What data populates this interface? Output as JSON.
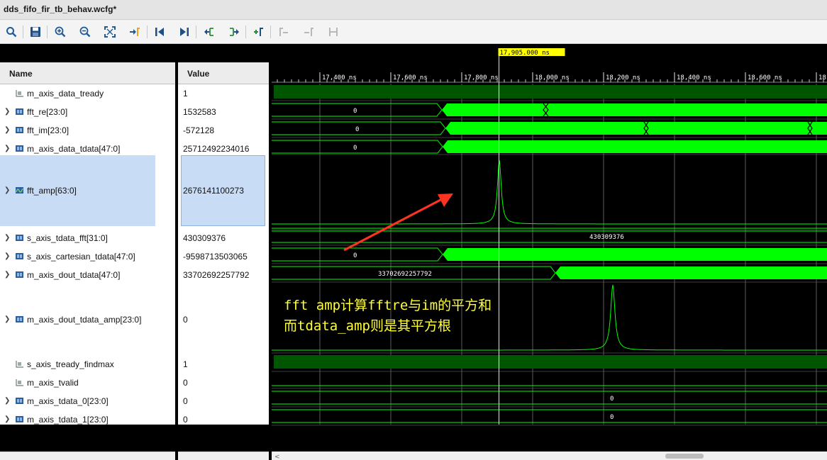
{
  "window": {
    "title": "dds_fifo_fir_tb_behav.wcfg*"
  },
  "toolbar": {
    "icons": [
      "search-icon",
      "save-icon",
      "zoom-in-icon",
      "zoom-out-icon",
      "zoom-fit-icon",
      "go-to-cursor-icon",
      "go-to-first-icon",
      "go-to-last-icon",
      "previous-transition-icon",
      "next-transition-icon",
      "add-marker-icon",
      "previous-marker-icon",
      "next-marker-icon",
      "swap-cursors-icon"
    ]
  },
  "panels": {
    "name_header": "Name",
    "value_header": "Value"
  },
  "signals": [
    {
      "name": "m_axis_data_tready",
      "value": "1",
      "expandable": false,
      "icon": "bit-signal-icon"
    },
    {
      "name": "fft_re[23:0]",
      "value": "1532583",
      "expandable": true,
      "icon": "bus-signal-icon"
    },
    {
      "name": "fft_im[23:0]",
      "value": "-572128",
      "expandable": true,
      "icon": "bus-signal-icon"
    },
    {
      "name": "m_axis_data_tdata[47:0]",
      "value": "25712492234016",
      "expandable": true,
      "icon": "bus-signal-icon"
    },
    {
      "name": "fft_amp[63:0]",
      "value": "2676141100273",
      "expandable": true,
      "icon": "analog-signal-icon",
      "selected": true
    },
    {
      "name": "s_axis_tdata_fft[31:0]",
      "value": "430309376",
      "expandable": true,
      "icon": "bus-signal-icon"
    },
    {
      "name": "s_axis_cartesian_tdata[47:0]",
      "value": "-9598713503065",
      "expandable": true,
      "icon": "bus-signal-icon"
    },
    {
      "name": "m_axis_dout_tdata[47:0]",
      "value": "33702692257792",
      "expandable": true,
      "icon": "bus-signal-icon"
    },
    {
      "name": "m_axis_dout_tdata_amp[23:0]",
      "value": "0",
      "expandable": true,
      "icon": "bus-signal-icon"
    },
    {
      "name": "s_axis_tready_findmax",
      "value": "1",
      "expandable": false,
      "icon": "bit-signal-icon"
    },
    {
      "name": "m_axis_tvalid",
      "value": "0",
      "expandable": false,
      "icon": "bit-signal-icon"
    },
    {
      "name": "m_axis_tdata_0[23:0]",
      "value": "0",
      "expandable": true,
      "icon": "bus-signal-icon"
    },
    {
      "name": "m_axis_tdata_1[23:0]",
      "value": "0",
      "expandable": true,
      "icon": "bus-signal-icon"
    }
  ],
  "timeline": {
    "cursor_label": "17,905.000 ns",
    "cursor_time_ns": 17905,
    "tick_labels": [
      "17,400 ns",
      "17,600 ns",
      "17,800 ns",
      "18,000 ns",
      "18,200 ns",
      "18,400 ns",
      "18,600 ns",
      "18"
    ],
    "tick_times_ns": [
      17400,
      17600,
      17800,
      18000,
      18200,
      18400,
      18600,
      18800
    ]
  },
  "wave_labels": {
    "fft_re_start": "0",
    "fft_im_start": "0",
    "m_axis_data_tdata_start": "0",
    "s_axis_tdata_fft_value": "430309376",
    "s_axis_cartesian_tdata_start": "0",
    "m_axis_dout_tdata_start": "33702692257792",
    "m_axis_tdata_0_value": "0",
    "m_axis_tdata_1_value": "0"
  },
  "annotation": {
    "line1": "fft amp计算fftre与im的平方和",
    "line2": "而tdata_amp则是其平方根",
    "color": "#ffff33"
  },
  "colors": {
    "bus_active": "#00ff00",
    "bit_high": "#005500",
    "cursor": "#ffff00",
    "arrow": "#ff3322"
  }
}
